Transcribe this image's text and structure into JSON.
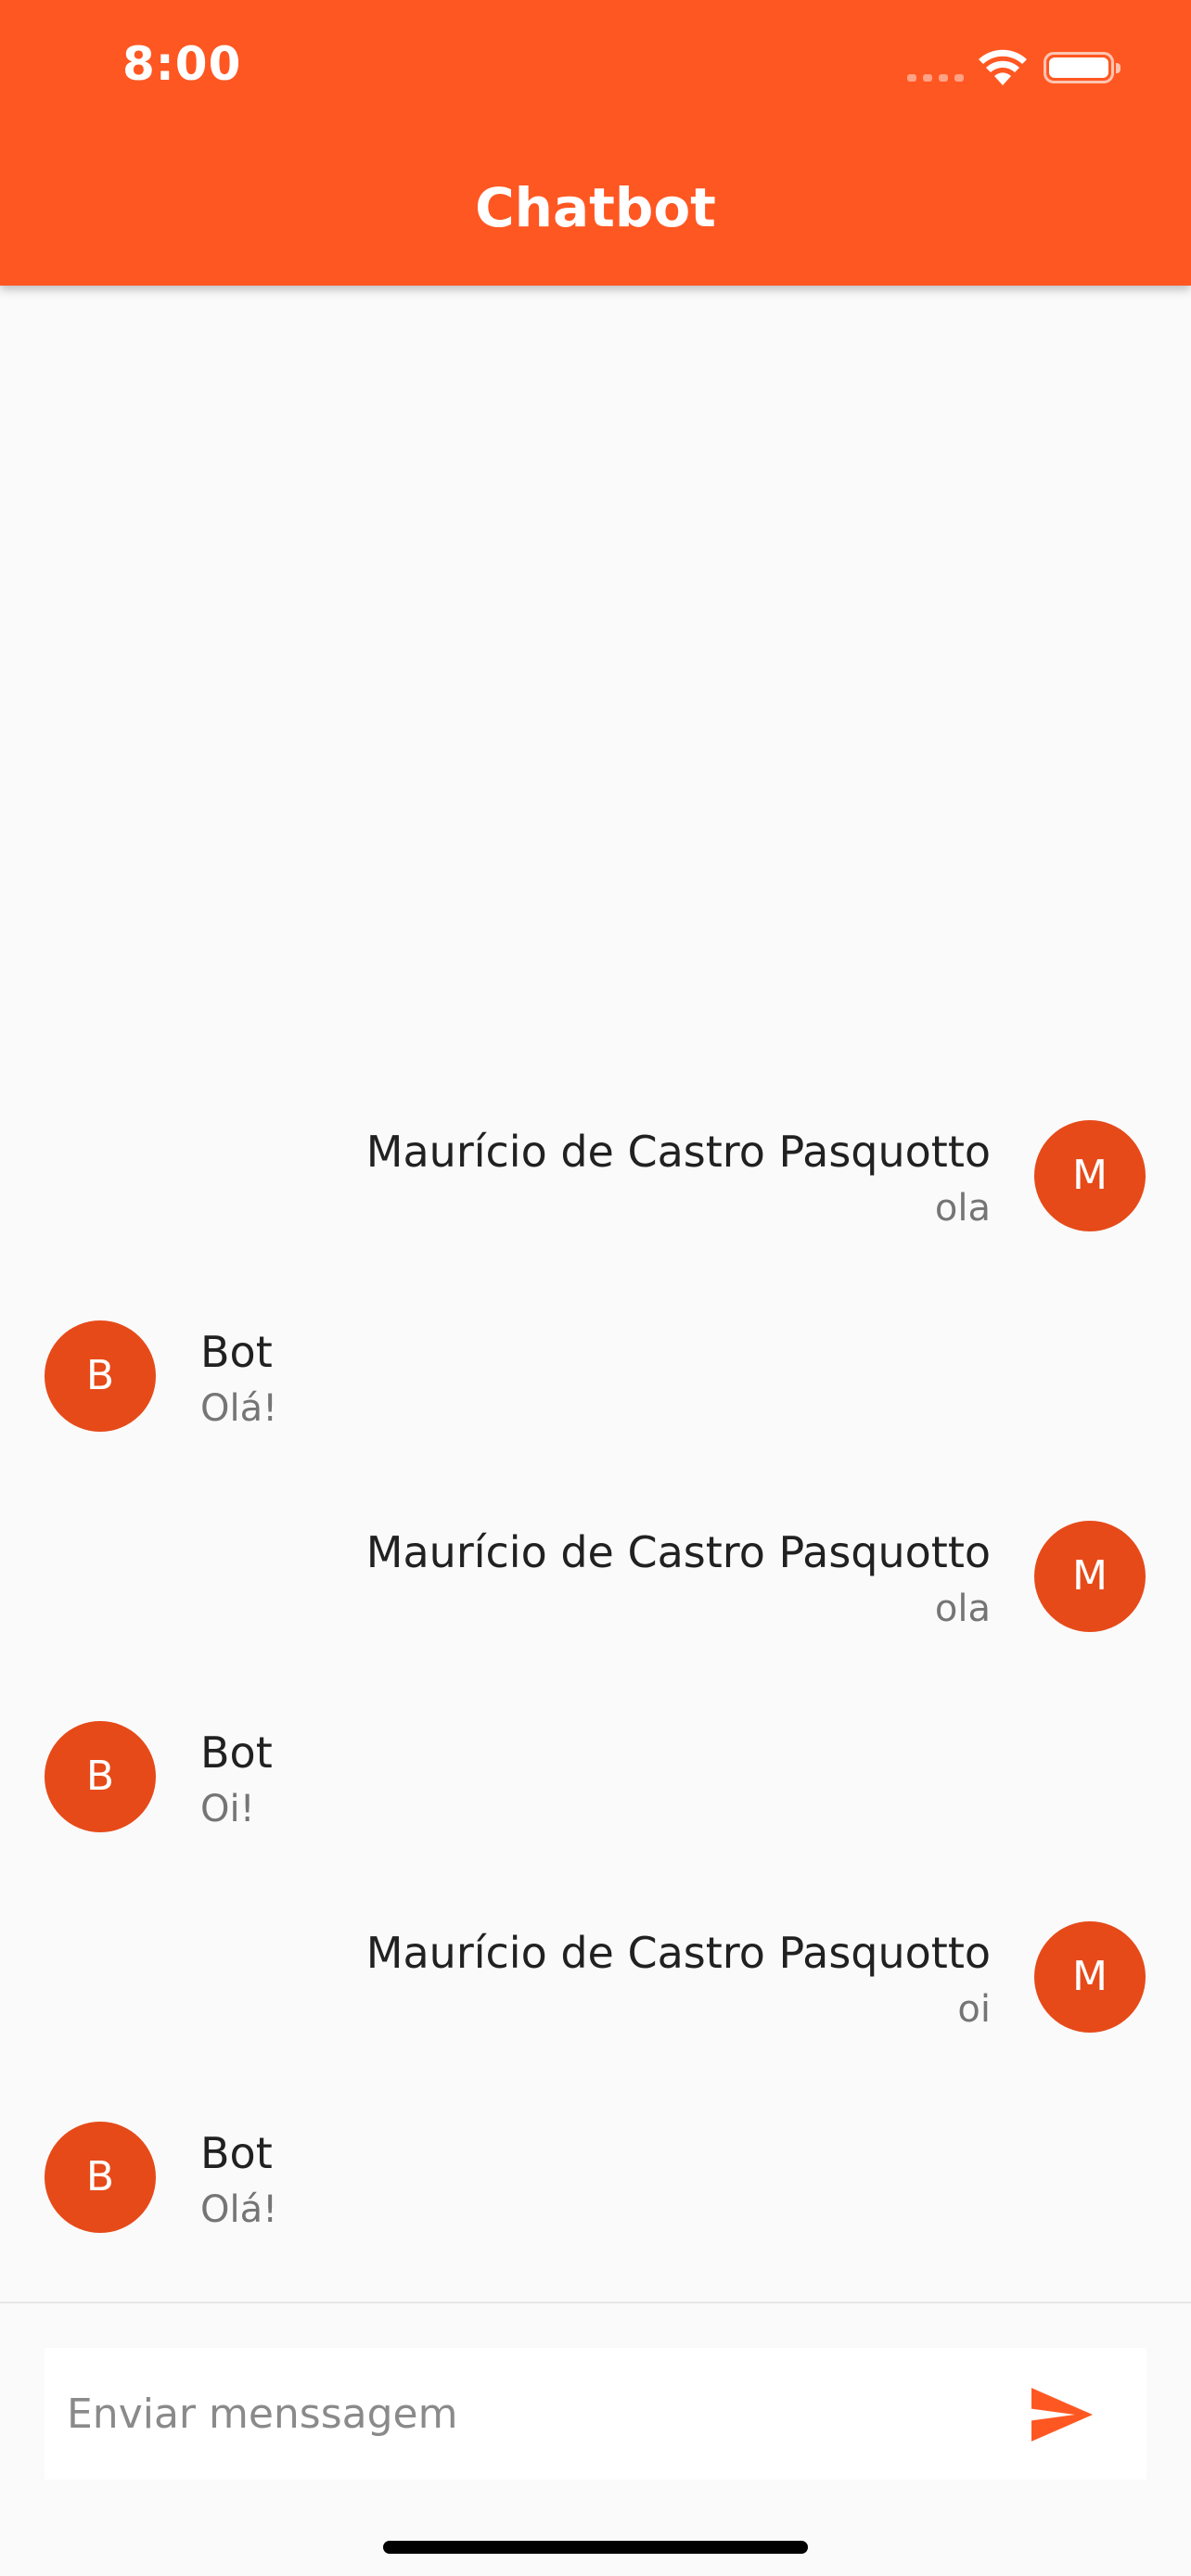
{
  "status_bar": {
    "time": "8:00",
    "icons": [
      "cellular-signal-icon",
      "wifi-icon",
      "battery-icon"
    ]
  },
  "header": {
    "title": "Chatbot",
    "background_color": "#ff5722"
  },
  "messages": [
    {
      "from": "user",
      "initial": "M",
      "sender": "Maurício de Castro Pasquotto",
      "text": "ola"
    },
    {
      "from": "bot",
      "initial": "B",
      "sender": "Bot",
      "text": "Olá!"
    },
    {
      "from": "user",
      "initial": "M",
      "sender": "Maurício de Castro Pasquotto",
      "text": "ola"
    },
    {
      "from": "bot",
      "initial": "B",
      "sender": "Bot",
      "text": "Oi!"
    },
    {
      "from": "user",
      "initial": "M",
      "sender": "Maurício de Castro Pasquotto",
      "text": "oi"
    },
    {
      "from": "bot",
      "initial": "B",
      "sender": "Bot",
      "text": "Olá!"
    }
  ],
  "composer": {
    "placeholder": "Enviar menssagem",
    "value": "",
    "send_icon": "send-icon"
  },
  "colors": {
    "accent": "#ff5722",
    "avatar": "#e64a19",
    "sender_text": "#212121",
    "message_text": "#757575"
  }
}
